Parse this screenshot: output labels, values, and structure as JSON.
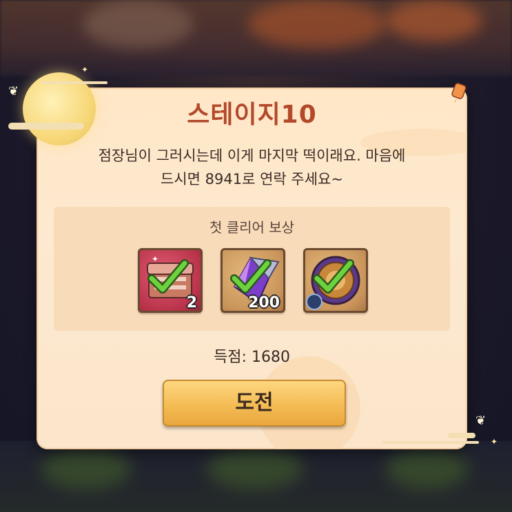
{
  "stage": {
    "title": "스테이지10",
    "description_line1": "점장님이 그러시는데 이게 마지막 떡이래요. 마음에",
    "description_line2": "드시면 8941로 연락 주세요~"
  },
  "rewards": {
    "title": "첫 클리어 보상",
    "items": [
      {
        "name": "treasure-chest",
        "count": "2",
        "claimed": true
      },
      {
        "name": "crystal-shards",
        "count": "200",
        "claimed": true
      },
      {
        "name": "timed-medallion",
        "count": "",
        "claimed": true
      }
    ]
  },
  "score": {
    "text": "득점: 1680"
  },
  "buttons": {
    "challenge_label": "도전"
  },
  "colors": {
    "title": "#b2492a",
    "dialog_bg": "#fde9cf",
    "button": "#f4bc55",
    "check": "#4caf30"
  }
}
